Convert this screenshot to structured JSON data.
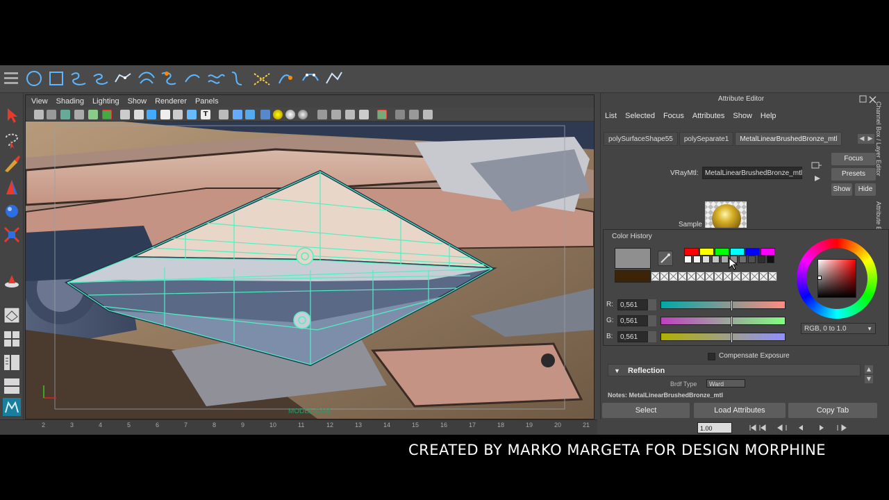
{
  "viewport": {
    "menu": [
      "View",
      "Shading",
      "Lighting",
      "Show",
      "Renderer",
      "Panels"
    ],
    "camera_label": "MODEL-CAM"
  },
  "attribute_editor": {
    "title": "Attribute Editor",
    "menu": [
      "List",
      "Selected",
      "Focus",
      "Attributes",
      "Show",
      "Help"
    ],
    "tabs": [
      {
        "label": "polySurfaceShape55",
        "active": false
      },
      {
        "label": "polySeparate1",
        "active": false
      },
      {
        "label": "MetalLinearBrushedBronze_mtl",
        "active": true
      }
    ],
    "node_type_label": "VRayMtl:",
    "node_name": "MetalLinearBrushedBronze_mtl",
    "focus_button": "Focus",
    "presets_button": "Presets",
    "show_button": "Show",
    "hide_button": "Hide",
    "sample_label": "Sample",
    "compensate_exposure_label": "Compensate Exposure",
    "reflection_section": "Reflection",
    "brdf_type_label": "Brdf Type",
    "brdf_type_value": "Ward",
    "notes_label": "Notes:  MetalLinearBrushedBronze_mtl",
    "bottom_buttons": {
      "select": "Select",
      "load_attributes": "Load Attributes",
      "copy_tab": "Copy Tab"
    },
    "side_tabs": [
      "Channel Box / Layer Editor",
      "Attribute Editor"
    ]
  },
  "color_history": {
    "title": "Color History",
    "current_color": "#8f8f8f",
    "previous_color": "#3b2407",
    "history_row1": [
      "#ff0000",
      "#ffff00",
      "#00ff00",
      "#00ffff",
      "#0000ff",
      "#ff00ff"
    ],
    "history_row2": [
      "#ffffff",
      "#f2f2f2",
      "#dcdcdc",
      "#c4c4c4",
      "#a9a9a9",
      "#8d8d8d",
      "#6f6f6f",
      "#505050",
      "#303030",
      "#111111"
    ],
    "channels": [
      {
        "label": "R:",
        "value": "0,561",
        "fraction": 0.561,
        "from": "#00a8a8",
        "to": "#ff8c80"
      },
      {
        "label": "G:",
        "value": "0,561",
        "fraction": 0.561,
        "from": "#c040c0",
        "to": "#80ff80"
      },
      {
        "label": "B:",
        "value": "0,561",
        "fraction": 0.561,
        "from": "#b0b000",
        "to": "#9090ff"
      }
    ],
    "mode": "RGB, 0 to 1.0"
  },
  "timeline": {
    "ticks": [
      "2",
      "3",
      "4",
      "5",
      "6",
      "7",
      "8",
      "9",
      "10",
      "11",
      "12",
      "13",
      "14",
      "15",
      "16",
      "17",
      "18",
      "19",
      "20",
      "21"
    ],
    "current_time": "1.00"
  },
  "credit_text": "CREATED BY MARKO MARGETA FOR DESIGN MORPHINE"
}
